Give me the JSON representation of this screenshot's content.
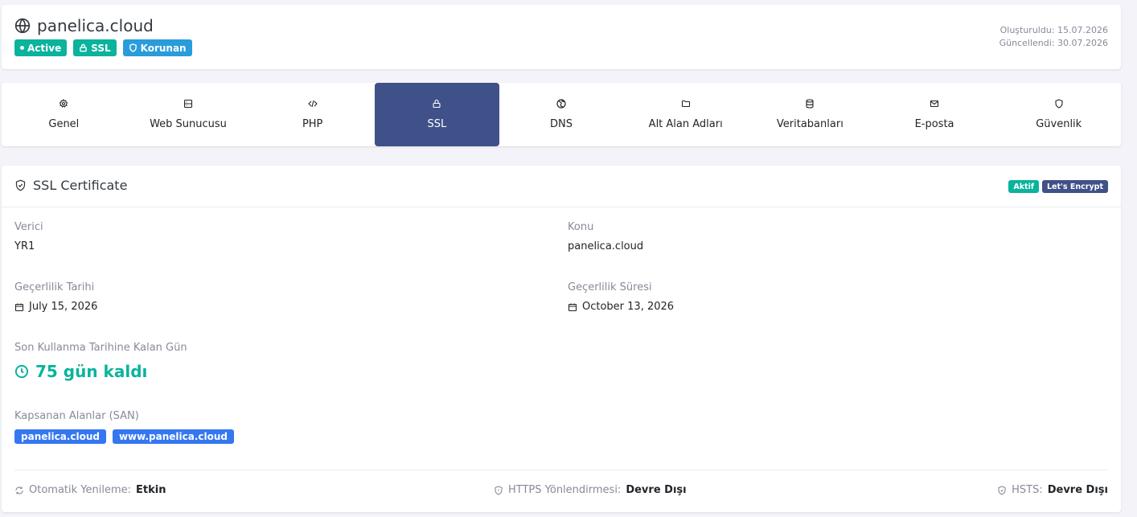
{
  "header": {
    "domain": "panelica.cloud",
    "badges": {
      "active": {
        "label": "Active",
        "color": "#0ab39c"
      },
      "ssl": {
        "label": "SSL",
        "color": "#0ab39c"
      },
      "protected": {
        "label": "Korunan",
        "color": "#299cdb"
      }
    },
    "created": "Oluşturuldu: 15.07.2026",
    "updated": "Güncellendi: 30.07.2026"
  },
  "tabs": [
    {
      "label": "Genel",
      "icon": "gear-icon"
    },
    {
      "label": "Web Sunucusu",
      "icon": "server-icon"
    },
    {
      "label": "PHP",
      "icon": "code-icon"
    },
    {
      "label": "SSL",
      "icon": "lock-icon",
      "active": true
    },
    {
      "label": "DNS",
      "icon": "globe-icon"
    },
    {
      "label": "Alt Alan Adları",
      "icon": "folder-icon"
    },
    {
      "label": "Veritabanları",
      "icon": "database-icon"
    },
    {
      "label": "E-posta",
      "icon": "mail-icon"
    },
    {
      "label": "Güvenlik",
      "icon": "shield-icon"
    }
  ],
  "ssl": {
    "title": "SSL Certificate",
    "status_badge": {
      "label": "Aktif",
      "color": "#0ab39c"
    },
    "provider_badge": {
      "label": "Let's Encrypt",
      "color": "#405189"
    },
    "issuer_label": "Verici",
    "issuer": "YR1",
    "subject_label": "Konu",
    "subject": "panelica.cloud",
    "valid_from_label": "Geçerlilik Tarihi",
    "valid_from": "July 15, 2026",
    "valid_to_label": "Geçerlilik Süresi",
    "valid_to": "October 13, 2026",
    "days_left_label": "Son Kullanma Tarihine Kalan Gün",
    "days_left": "75 gün kaldı",
    "san_label": "Kapsanan Alanlar (SAN)",
    "san": [
      "panelica.cloud",
      "www.panelica.cloud"
    ],
    "auto_renew_label": "Otomatik Yenileme:",
    "auto_renew": "Etkin",
    "https_redirect_label": "HTTPS Yönlendirmesi:",
    "https_redirect": "Devre Dışı",
    "hsts_label": "HSTS:",
    "hsts": "Devre Dışı"
  },
  "colors": {
    "primary": "#405189",
    "success": "#0ab39c",
    "info": "#299cdb",
    "san_blue": "#3577f1"
  }
}
